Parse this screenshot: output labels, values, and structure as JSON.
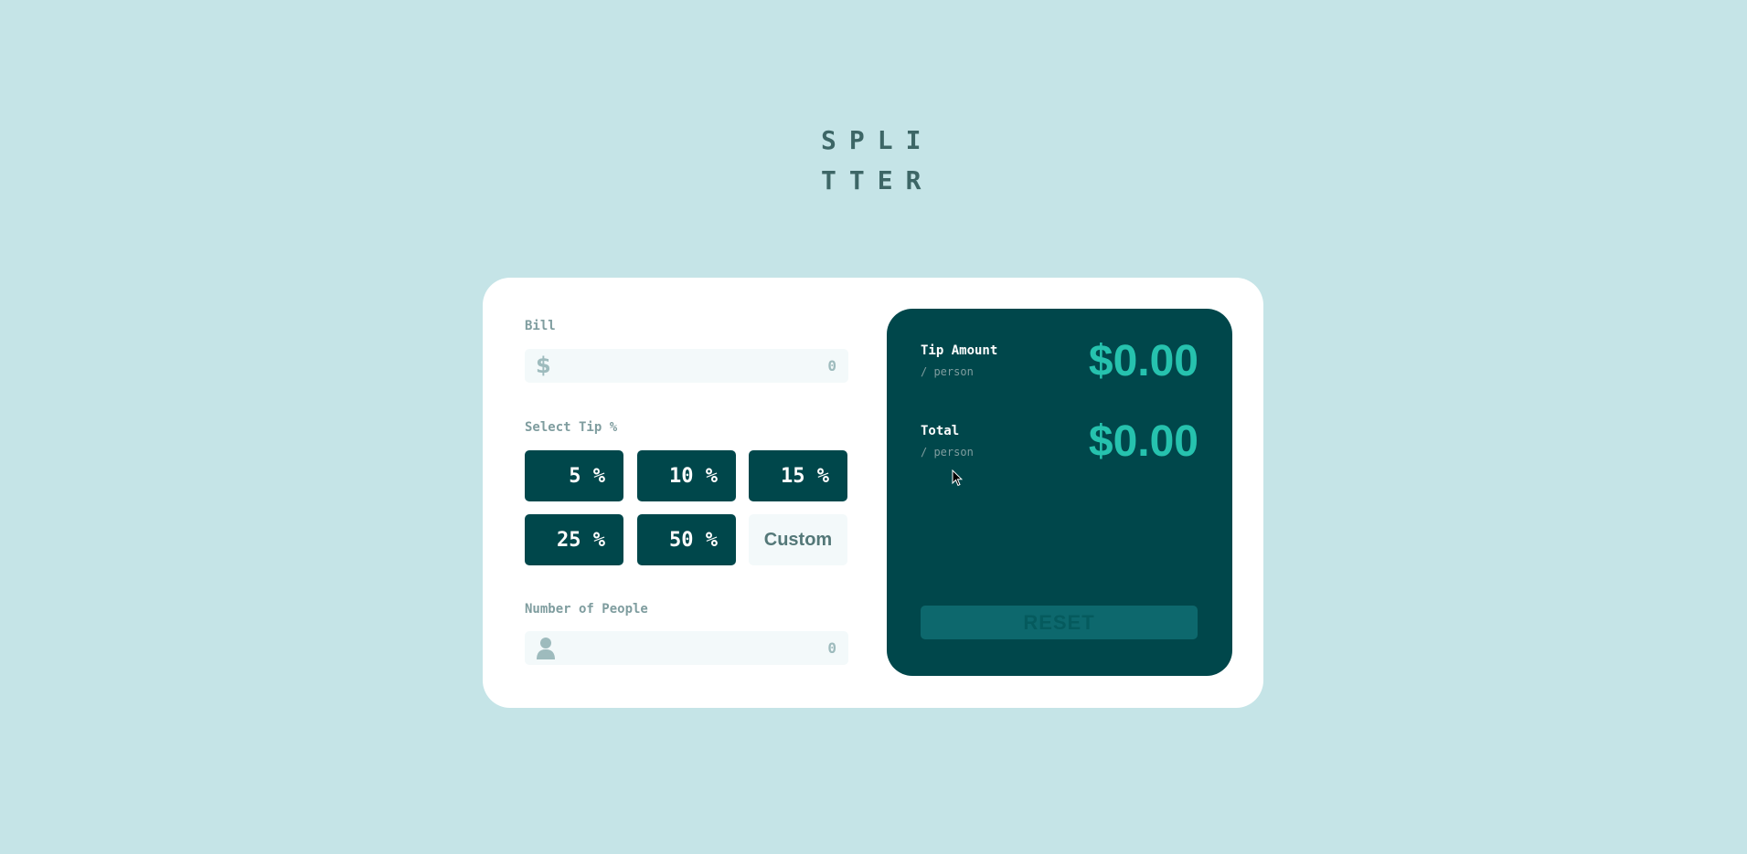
{
  "logo": {
    "line1": "SPLI",
    "line2": "TTER"
  },
  "bill": {
    "label": "Bill",
    "icon": "dollar-icon",
    "icon_glyph": "$",
    "placeholder": "0"
  },
  "tip": {
    "label": "Select Tip %",
    "options": [
      "5 %",
      "10 %",
      "15 %",
      "25 %",
      "50 %"
    ],
    "custom_label": "Custom"
  },
  "people": {
    "label": "Number of People",
    "icon": "person-icon",
    "placeholder": "0"
  },
  "results": {
    "tip_amount": {
      "title": "Tip Amount",
      "sub": "/ person",
      "value": "$0.00"
    },
    "total": {
      "title": "Total",
      "sub": "/ person",
      "value": "$0.00"
    },
    "reset_label": "RESET"
  },
  "colors": {
    "background": "#c5e4e7",
    "card": "#ffffff",
    "dark_cyan": "#00474b",
    "accent": "#26c2ae",
    "input_bg": "#f3f9fa",
    "label_grey": "#7f9d9f",
    "reset_disabled": "#0d686d"
  }
}
